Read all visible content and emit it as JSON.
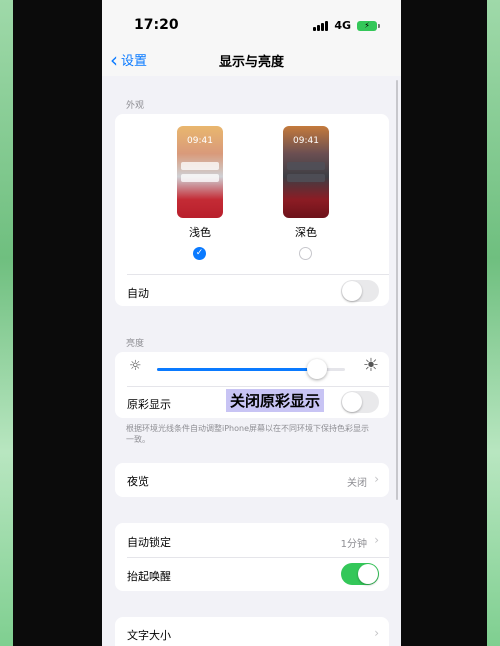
{
  "status": {
    "time": "17:20",
    "network": "4G",
    "battery_icon": "battery-charging-icon"
  },
  "nav": {
    "back_label": "设置",
    "title": "显示与亮度"
  },
  "appearance": {
    "section_label": "外观",
    "light": {
      "label": "浅色",
      "clock": "09:41",
      "selected": true
    },
    "dark": {
      "label": "深色",
      "clock": "09:41",
      "selected": false
    },
    "auto_label": "自动",
    "auto_on": false
  },
  "brightness": {
    "section_label": "亮度",
    "level": 0.85,
    "true_tone_label": "原彩显示",
    "true_tone_on": false,
    "note": "根据环境光线条件自动调整iPhone屏幕以在不同环境下保持色彩显示一致。"
  },
  "night_shift": {
    "label": "夜览",
    "value": "关闭"
  },
  "lock": {
    "auto_lock_label": "自动锁定",
    "auto_lock_value": "1分钟",
    "raise_to_wake_label": "抬起唤醒",
    "raise_to_wake_on": true
  },
  "text_size": {
    "label": "文字大小"
  },
  "caption_overlay": "关闭原彩显示",
  "colors": {
    "accent": "#0a7aff",
    "toggle_on": "#34c759",
    "frame": "#7fcf90"
  }
}
